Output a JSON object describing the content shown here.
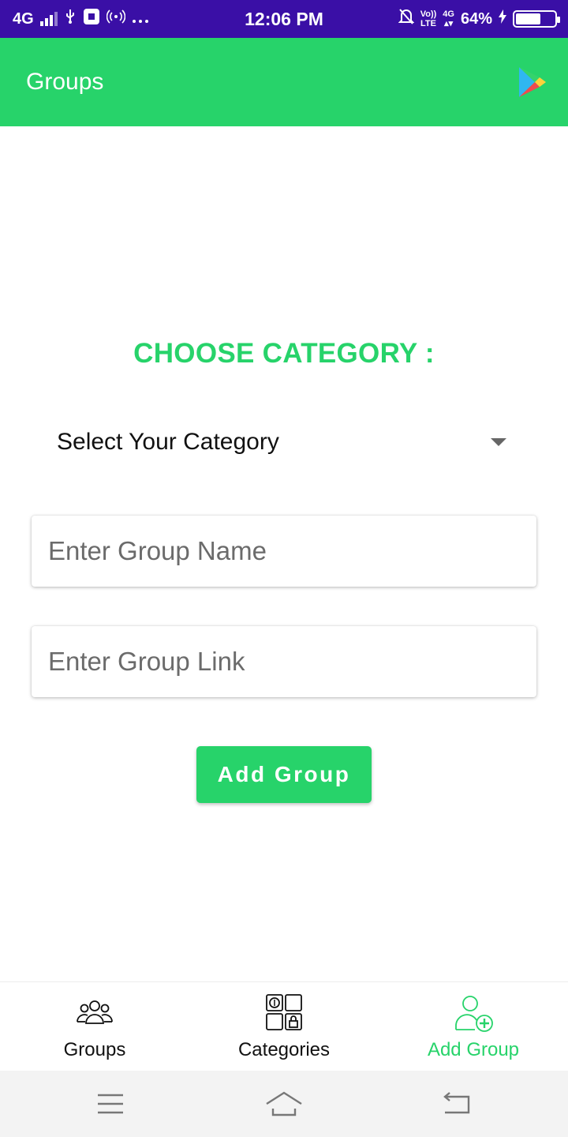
{
  "status_bar": {
    "network": "4G",
    "time": "12:06 PM",
    "volte_top": "Vo))",
    "volte_bottom": "LTE",
    "network2": "4G",
    "battery": "64%",
    "battery_level": 0.64
  },
  "app_bar": {
    "title": "Groups",
    "action_icon": "play-store-icon"
  },
  "form": {
    "heading": "CHOOSE CATEGORY :",
    "category_select": {
      "selected": "Select Your Category"
    },
    "group_name_placeholder": "Enter Group Name",
    "group_name_value": "",
    "group_link_placeholder": "Enter Group Link",
    "group_link_value": "",
    "submit_label": "Add Group"
  },
  "bottom_nav": {
    "items": [
      {
        "label": "Groups",
        "icon": "groups-icon",
        "active": false
      },
      {
        "label": "Categories",
        "icon": "categories-icon",
        "active": false
      },
      {
        "label": "Add Group",
        "icon": "add-user-icon",
        "active": true
      }
    ]
  },
  "colors": {
    "status_bar": "#3a0fa6",
    "primary": "#27d36a",
    "text": "#111111"
  }
}
